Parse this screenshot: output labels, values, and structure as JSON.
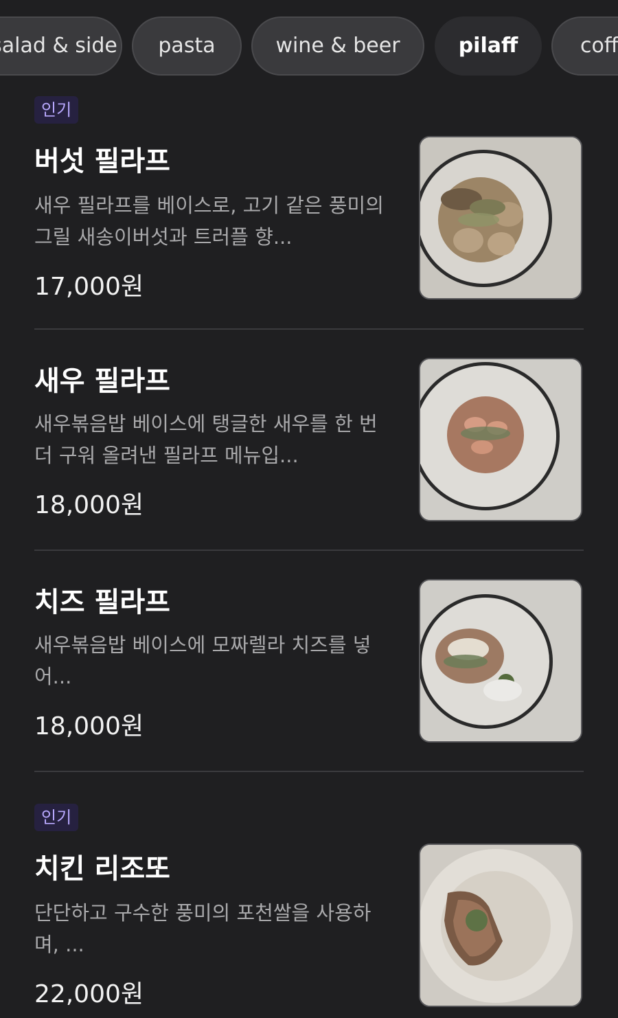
{
  "categories": [
    {
      "label": "salad & side"
    },
    {
      "label": "pasta"
    },
    {
      "label": "wine & beer"
    },
    {
      "label": "pilaff",
      "active": true
    },
    {
      "label": "coffee"
    }
  ],
  "items": [
    {
      "badge": "인기",
      "name": "버섯 필라프",
      "description": "새우 필라프를 베이스로, 고기 같은 풍미의 그릴 새송이버섯과 트러플 향...",
      "price": "17,000원",
      "image_icon": "mushroom-pilaf-photo"
    },
    {
      "badge": "",
      "name": "새우 필라프",
      "description": "새우볶음밥 베이스에 탱글한 새우를 한 번 더 구워 올려낸 필라프 메뉴입...",
      "price": "18,000원",
      "image_icon": "shrimp-pilaf-photo"
    },
    {
      "badge": "",
      "name": "치즈 필라프",
      "description": "새우볶음밥 베이스에 모짜렐라 치즈를 넣어...",
      "price": "18,000원",
      "image_icon": "cheese-pilaf-photo"
    },
    {
      "badge": "인기",
      "name": "치킨 리조또",
      "description": "단단하고 구수한 풍미의 포천쌀을 사용하며, ...",
      "price": "22,000원",
      "image_icon": "chicken-risotto-photo"
    }
  ],
  "colors": {
    "background": "#1f1f21",
    "badge_bg": "#262140",
    "badge_text": "#b9a9ff"
  }
}
